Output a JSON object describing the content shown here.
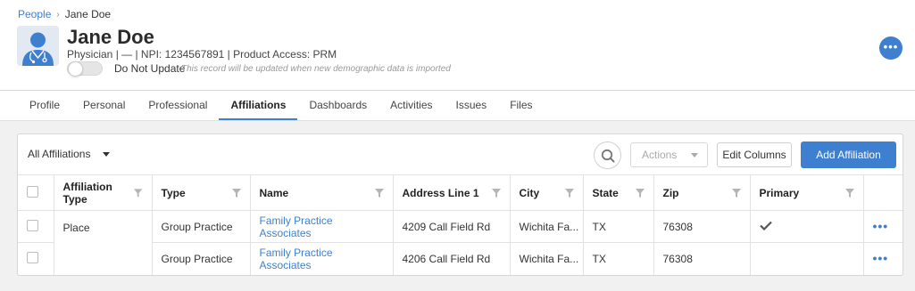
{
  "breadcrumb": {
    "root": "People",
    "current": "Jane Doe"
  },
  "person": {
    "name": "Jane Doe",
    "subtitle": "Physician | — | NPI: 1234567891 | Product Access: PRM",
    "do_not_update_label": "Do Not Update",
    "do_not_update_note": "This record will be updated when new demographic data is imported",
    "do_not_update_on": false
  },
  "icons": {
    "avatar": "doctor-avatar-icon",
    "more": "more-options-icon",
    "search": "search-icon",
    "filter": "filter-icon",
    "check": "check-icon",
    "row_menu": "ellipsis-icon"
  },
  "colors": {
    "accent": "#3f7fcf",
    "page_bg": "#f1f1f1"
  },
  "tabs": [
    {
      "label": "Profile",
      "active": false
    },
    {
      "label": "Personal",
      "active": false
    },
    {
      "label": "Professional",
      "active": false
    },
    {
      "label": "Affiliations",
      "active": true
    },
    {
      "label": "Dashboards",
      "active": false
    },
    {
      "label": "Activities",
      "active": false
    },
    {
      "label": "Issues",
      "active": false
    },
    {
      "label": "Files",
      "active": false
    }
  ],
  "toolbar": {
    "filter_value": "All Affiliations",
    "actions_label": "Actions",
    "edit_columns_label": "Edit Columns",
    "add_label": "Add Affiliation"
  },
  "table": {
    "columns": [
      "Affiliation Type",
      "Type",
      "Name",
      "Address Line 1",
      "City",
      "State",
      "Zip",
      "Primary"
    ],
    "group_label": "Place",
    "rows": [
      {
        "type": "Group Practice",
        "name": "Family Practice Associates",
        "address": "4209 Call Field Rd",
        "city": "Wichita Fa...",
        "state": "TX",
        "zip": "76308",
        "primary": true
      },
      {
        "type": "Group Practice",
        "name": "Family Practice Associates",
        "address": "4206 Call Field Rd",
        "city": "Wichita Fa...",
        "state": "TX",
        "zip": "76308",
        "primary": false
      }
    ]
  }
}
